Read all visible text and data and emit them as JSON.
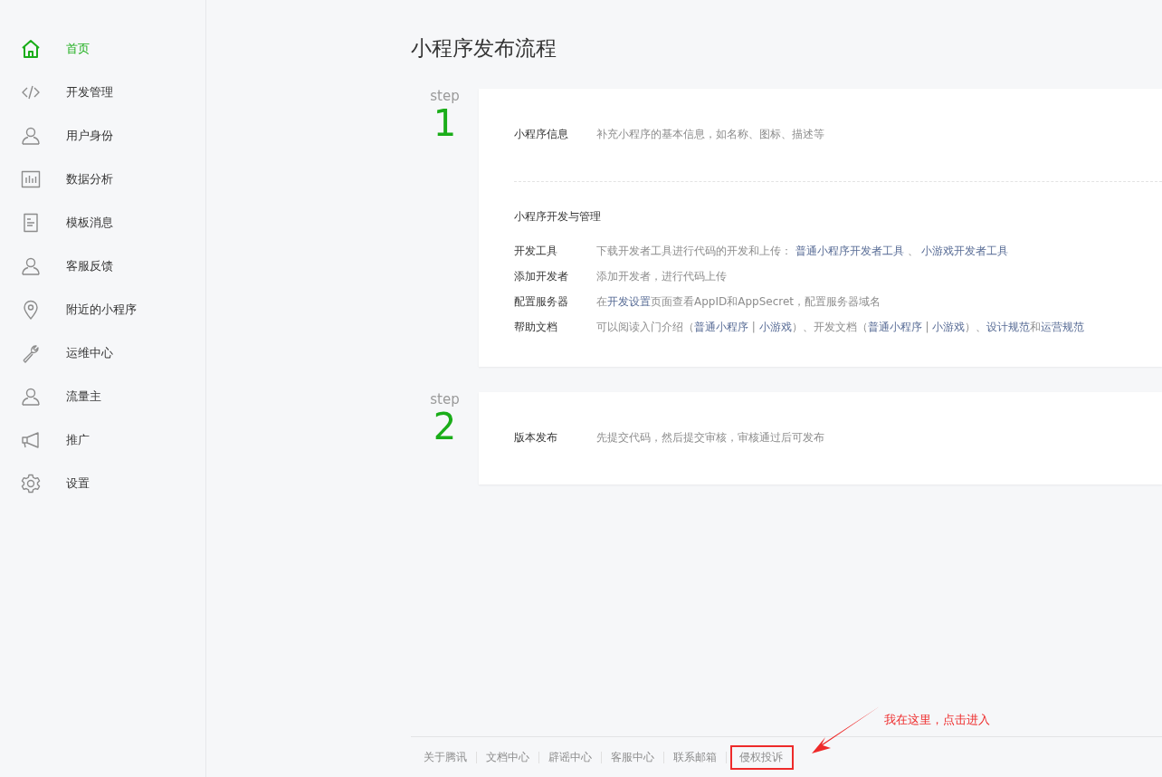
{
  "sidebar": {
    "items": [
      {
        "label": "首页",
        "selected": true
      },
      {
        "label": "开发管理",
        "selected": false
      },
      {
        "label": "用户身份",
        "selected": false
      },
      {
        "label": "数据分析",
        "selected": false
      },
      {
        "label": "模板消息",
        "selected": false
      },
      {
        "label": "客服反馈",
        "selected": false
      },
      {
        "label": "附近的小程序",
        "selected": false
      },
      {
        "label": "运维中心",
        "selected": false
      },
      {
        "label": "流量主",
        "selected": false
      },
      {
        "label": "推广",
        "selected": false
      },
      {
        "label": "设置",
        "selected": false
      }
    ]
  },
  "page_title": "小程序发布流程",
  "steps": [
    {
      "step_label": "step",
      "number": "1",
      "sections": [
        {
          "rows": [
            {
              "label": "小程序信息",
              "description": [
                {
                  "text": "补充小程序的基本信息，如名称、图标、描述等",
                  "link": false
                }
              ]
            }
          ]
        },
        {
          "title": "小程序开发与管理",
          "rows": [
            {
              "label": "开发工具",
              "description": [
                {
                  "text": "下载开发者工具进行代码的开发和上传： ",
                  "link": false
                },
                {
                  "text": "普通小程序开发者工具",
                  "link": true
                },
                {
                  "text": " 、 ",
                  "link": false
                },
                {
                  "text": "小游戏开发者工具",
                  "link": true
                }
              ]
            },
            {
              "label": "添加开发者",
              "description": [
                {
                  "text": "添加开发者，进行代码上传",
                  "link": false
                }
              ]
            },
            {
              "label": "配置服务器",
              "description": [
                {
                  "text": "在",
                  "link": false
                },
                {
                  "text": "开发设置",
                  "link": true
                },
                {
                  "text": "页面查看AppID和AppSecret，配置服务器域名",
                  "link": false
                }
              ]
            },
            {
              "label": "帮助文档",
              "description": [
                {
                  "text": "可以阅读入门介绍（",
                  "link": false
                },
                {
                  "text": "普通小程序",
                  "link": true
                },
                {
                  "text": " | ",
                  "link": false
                },
                {
                  "text": "小游戏",
                  "link": true
                },
                {
                  "text": "）、开发文档（",
                  "link": false
                },
                {
                  "text": "普通小程序",
                  "link": true
                },
                {
                  "text": " | ",
                  "link": false
                },
                {
                  "text": "小游戏",
                  "link": true
                },
                {
                  "text": "）、",
                  "link": false
                },
                {
                  "text": "设计规范",
                  "link": true
                },
                {
                  "text": "和",
                  "link": false
                },
                {
                  "text": "运营规范",
                  "link": true
                }
              ]
            }
          ]
        }
      ]
    },
    {
      "step_label": "step",
      "number": "2",
      "sections": [
        {
          "rows": [
            {
              "label": "版本发布",
              "description": [
                {
                  "text": "先提交代码，然后提交审核，审核通过后可发布",
                  "link": false
                }
              ]
            }
          ]
        }
      ]
    }
  ],
  "footer": {
    "links": [
      {
        "label": "关于腾讯",
        "highlighted": false
      },
      {
        "label": "文档中心",
        "highlighted": false
      },
      {
        "label": "辟谣中心",
        "highlighted": false
      },
      {
        "label": "客服中心",
        "highlighted": false
      },
      {
        "label": "联系邮箱",
        "highlighted": false
      },
      {
        "label": "侵权投诉",
        "highlighted": true
      }
    ]
  },
  "annotation": {
    "text": "我在这里，点击进入"
  }
}
